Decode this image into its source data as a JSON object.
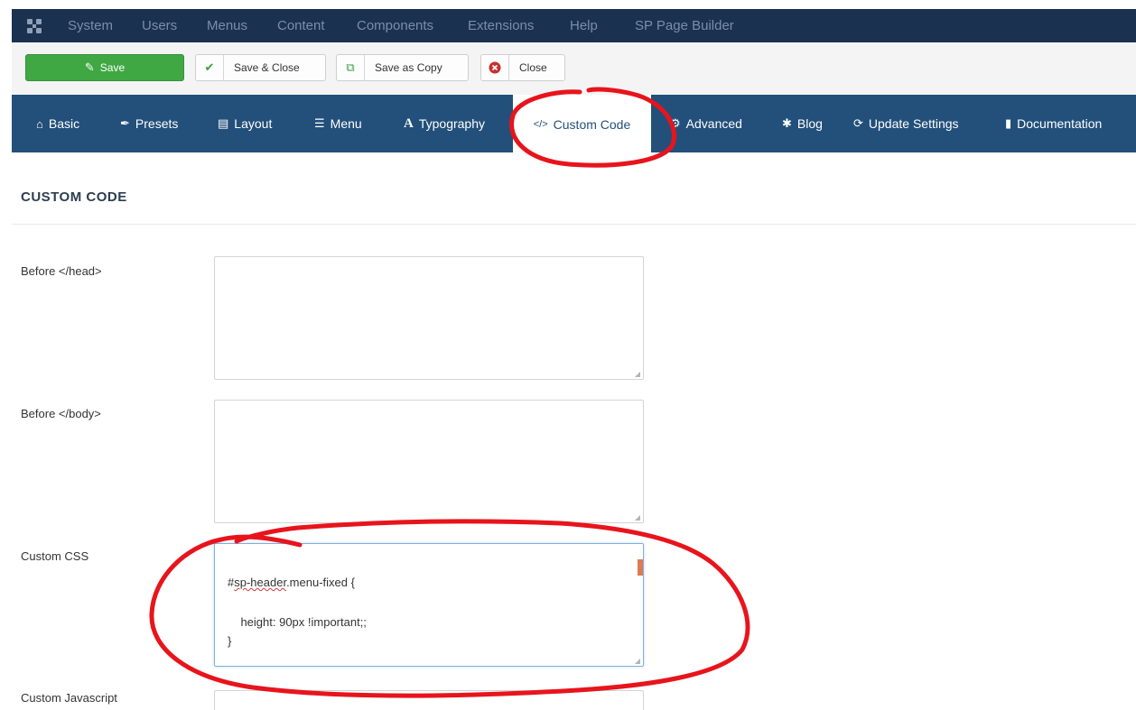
{
  "topbar": {
    "items": [
      "System",
      "Users",
      "Menus",
      "Content",
      "Components",
      "Extensions",
      "Help",
      "SP Page Builder"
    ]
  },
  "toolbar": {
    "save_label": "Save",
    "save_close_label": "Save & Close",
    "save_copy_label": "Save as Copy",
    "close_label": "Close"
  },
  "tabs": [
    {
      "label": "Basic",
      "icon": "home-icon"
    },
    {
      "label": "Presets",
      "icon": "brush-icon"
    },
    {
      "label": "Layout",
      "icon": "layout-icon"
    },
    {
      "label": "Menu",
      "icon": "list-icon"
    },
    {
      "label": "Typography",
      "icon": "font-icon"
    },
    {
      "label": "Custom Code",
      "icon": "code-icon",
      "active": true
    },
    {
      "label": "Advanced",
      "icon": "cog-icon"
    },
    {
      "label": "Blog",
      "icon": "pin-icon"
    },
    {
      "label": "Update Settings",
      "icon": "refresh-icon"
    },
    {
      "label": "Documentation",
      "icon": "book-icon"
    }
  ],
  "section": {
    "title": "CUSTOM CODE"
  },
  "fields": {
    "before_head": {
      "label": "Before </head>",
      "value": ""
    },
    "before_body": {
      "label": "Before </body>",
      "value": ""
    },
    "custom_css": {
      "label": "Custom CSS",
      "lines": [
        "#sp-header.menu-fixed {",
        "    height: 90px !important;;",
        "}"
      ],
      "misspelled": "sp-header"
    },
    "custom_js": {
      "label": "Custom Javascript"
    }
  },
  "colors": {
    "topbar": "#1a3150",
    "tabbar": "#22507a",
    "save_button": "#3fa843",
    "annotation": "#e8141c"
  }
}
